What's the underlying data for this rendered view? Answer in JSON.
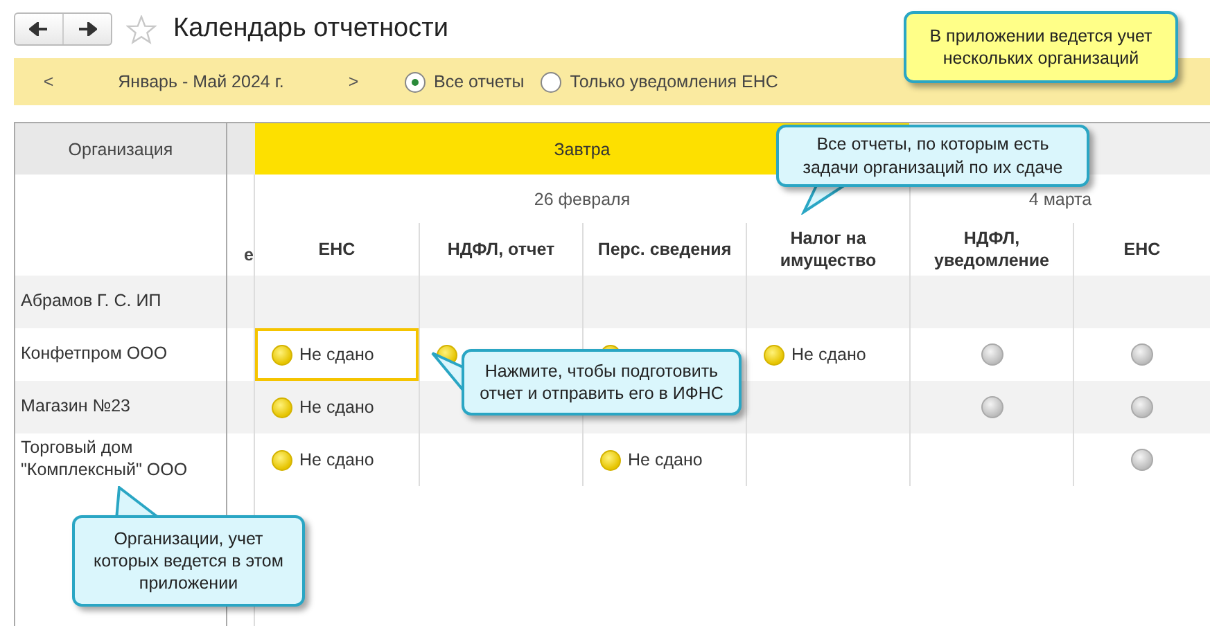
{
  "title": "Календарь отчетности",
  "period": {
    "prev": "<",
    "label": "Январь - Май 2024 г.",
    "next": ">"
  },
  "filters": [
    {
      "label": "Все отчеты",
      "selected": true
    },
    {
      "label": "Только уведомления ЕНС",
      "selected": false
    }
  ],
  "table": {
    "org_header": "Организация",
    "column_2_header": "е",
    "groups": [
      {
        "label": "Завтра",
        "date": "26 февраля",
        "highlighted": true,
        "columns": [
          "ЕНС",
          "НДФЛ, отчет",
          "Перс. сведения",
          "Налог на имущество"
        ]
      },
      {
        "date": "4 марта",
        "highlighted": false,
        "columns": [
          "НДФЛ, уведомление",
          "ЕНС"
        ]
      }
    ],
    "rows": [
      {
        "organization": "Абрамов Г. С. ИП",
        "cells": [
          {
            "kind": "empty",
            "selected": false
          },
          {
            "kind": "empty",
            "selected": false
          },
          {
            "kind": "empty",
            "selected": false
          },
          {
            "kind": "empty",
            "selected": false
          },
          {
            "kind": "empty",
            "selected": false
          },
          {
            "kind": "empty",
            "selected": false
          }
        ]
      },
      {
        "organization": "Конфетпром ООО",
        "cells": [
          {
            "kind": "pending",
            "text": "Не сдано",
            "selected": true
          },
          {
            "kind": "pending",
            "selected": false
          },
          {
            "kind": "pending",
            "selected": false
          },
          {
            "kind": "pending",
            "text": "Не сдано",
            "selected": false
          },
          {
            "kind": "none",
            "selected": false
          },
          {
            "kind": "none",
            "selected": false
          }
        ]
      },
      {
        "organization": "Магазин №23",
        "cells": [
          {
            "kind": "pending",
            "text": "Не сдано",
            "selected": false
          },
          {
            "kind": "empty",
            "selected": false
          },
          {
            "kind": "empty",
            "selected": false
          },
          {
            "kind": "empty",
            "selected": false
          },
          {
            "kind": "none",
            "selected": false
          },
          {
            "kind": "none",
            "selected": false
          }
        ]
      },
      {
        "organization": "Торговый дом \"Комплексный\" ООО",
        "cells": [
          {
            "kind": "pending",
            "text": "Не сдано",
            "selected": false
          },
          {
            "kind": "empty",
            "selected": false
          },
          {
            "kind": "pending",
            "text": "Не сдано",
            "selected": false
          },
          {
            "kind": "empty",
            "selected": false
          },
          {
            "kind": "empty",
            "selected": false
          },
          {
            "kind": "none",
            "selected": false
          }
        ]
      }
    ]
  },
  "callouts": [
    {
      "text": "В приложении ведется учет нескольких организаций",
      "color": "#ffff88"
    },
    {
      "text": "Все отчеты, по которым есть задачи организаций по их сдаче",
      "color": "#daf6fc"
    },
    {
      "text": "Нажмите, чтобы подготовить отчет и отправить его в ИФНС",
      "color": "#daf6fc"
    },
    {
      "text": "Организации, учет которых ведется в этом приложении",
      "color": "#daf6fc"
    }
  ]
}
